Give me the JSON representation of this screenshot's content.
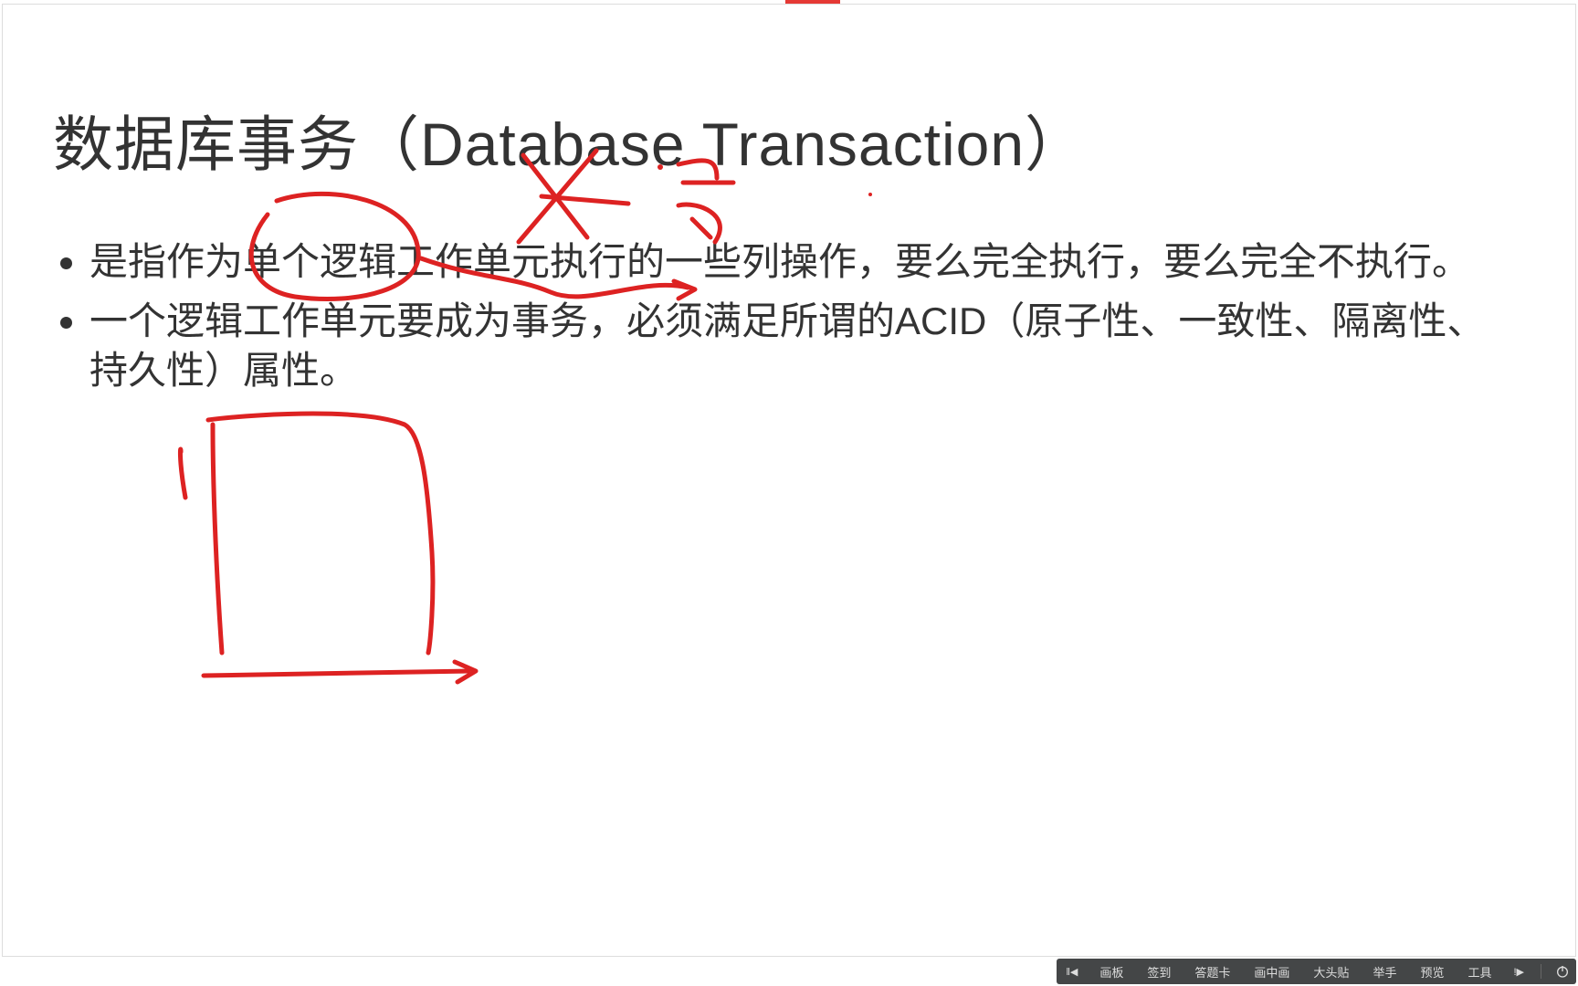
{
  "slide": {
    "title": "数据库事务（Database Transaction）",
    "bullets": [
      "是指作为单个逻辑工作单元执行的一些列操作，要么完全执行，要么完全不执行。",
      "一个逻辑工作单元要成为事务，必须满足所谓的ACID（原子性、一致性、隔离性、持久性）属性。"
    ]
  },
  "annotations": {
    "color": "#d22",
    "strokes": "handwritten red marks over slide"
  },
  "toolbar": {
    "items": [
      "画板",
      "签到",
      "答题卡",
      "画中画",
      "大头贴",
      "举手",
      "预览",
      "工具"
    ],
    "prev_icon": "‖◀",
    "next_icon": "!▶"
  }
}
